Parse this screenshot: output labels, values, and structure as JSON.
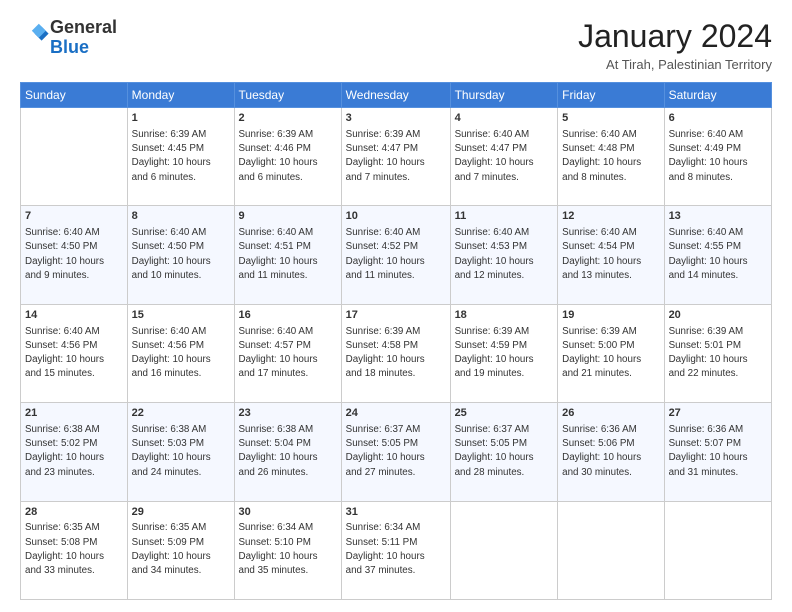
{
  "header": {
    "logo_general": "General",
    "logo_blue": "Blue",
    "month_title": "January 2024",
    "location": "At Tirah, Palestinian Territory"
  },
  "columns": [
    "Sunday",
    "Monday",
    "Tuesday",
    "Wednesday",
    "Thursday",
    "Friday",
    "Saturday"
  ],
  "weeks": [
    [
      {
        "day": "",
        "info": ""
      },
      {
        "day": "1",
        "info": "Sunrise: 6:39 AM\nSunset: 4:45 PM\nDaylight: 10 hours\nand 6 minutes."
      },
      {
        "day": "2",
        "info": "Sunrise: 6:39 AM\nSunset: 4:46 PM\nDaylight: 10 hours\nand 6 minutes."
      },
      {
        "day": "3",
        "info": "Sunrise: 6:39 AM\nSunset: 4:47 PM\nDaylight: 10 hours\nand 7 minutes."
      },
      {
        "day": "4",
        "info": "Sunrise: 6:40 AM\nSunset: 4:47 PM\nDaylight: 10 hours\nand 7 minutes."
      },
      {
        "day": "5",
        "info": "Sunrise: 6:40 AM\nSunset: 4:48 PM\nDaylight: 10 hours\nand 8 minutes."
      },
      {
        "day": "6",
        "info": "Sunrise: 6:40 AM\nSunset: 4:49 PM\nDaylight: 10 hours\nand 8 minutes."
      }
    ],
    [
      {
        "day": "7",
        "info": "Sunrise: 6:40 AM\nSunset: 4:50 PM\nDaylight: 10 hours\nand 9 minutes."
      },
      {
        "day": "8",
        "info": "Sunrise: 6:40 AM\nSunset: 4:50 PM\nDaylight: 10 hours\nand 10 minutes."
      },
      {
        "day": "9",
        "info": "Sunrise: 6:40 AM\nSunset: 4:51 PM\nDaylight: 10 hours\nand 11 minutes."
      },
      {
        "day": "10",
        "info": "Sunrise: 6:40 AM\nSunset: 4:52 PM\nDaylight: 10 hours\nand 11 minutes."
      },
      {
        "day": "11",
        "info": "Sunrise: 6:40 AM\nSunset: 4:53 PM\nDaylight: 10 hours\nand 12 minutes."
      },
      {
        "day": "12",
        "info": "Sunrise: 6:40 AM\nSunset: 4:54 PM\nDaylight: 10 hours\nand 13 minutes."
      },
      {
        "day": "13",
        "info": "Sunrise: 6:40 AM\nSunset: 4:55 PM\nDaylight: 10 hours\nand 14 minutes."
      }
    ],
    [
      {
        "day": "14",
        "info": "Sunrise: 6:40 AM\nSunset: 4:56 PM\nDaylight: 10 hours\nand 15 minutes."
      },
      {
        "day": "15",
        "info": "Sunrise: 6:40 AM\nSunset: 4:56 PM\nDaylight: 10 hours\nand 16 minutes."
      },
      {
        "day": "16",
        "info": "Sunrise: 6:40 AM\nSunset: 4:57 PM\nDaylight: 10 hours\nand 17 minutes."
      },
      {
        "day": "17",
        "info": "Sunrise: 6:39 AM\nSunset: 4:58 PM\nDaylight: 10 hours\nand 18 minutes."
      },
      {
        "day": "18",
        "info": "Sunrise: 6:39 AM\nSunset: 4:59 PM\nDaylight: 10 hours\nand 19 minutes."
      },
      {
        "day": "19",
        "info": "Sunrise: 6:39 AM\nSunset: 5:00 PM\nDaylight: 10 hours\nand 21 minutes."
      },
      {
        "day": "20",
        "info": "Sunrise: 6:39 AM\nSunset: 5:01 PM\nDaylight: 10 hours\nand 22 minutes."
      }
    ],
    [
      {
        "day": "21",
        "info": "Sunrise: 6:38 AM\nSunset: 5:02 PM\nDaylight: 10 hours\nand 23 minutes."
      },
      {
        "day": "22",
        "info": "Sunrise: 6:38 AM\nSunset: 5:03 PM\nDaylight: 10 hours\nand 24 minutes."
      },
      {
        "day": "23",
        "info": "Sunrise: 6:38 AM\nSunset: 5:04 PM\nDaylight: 10 hours\nand 26 minutes."
      },
      {
        "day": "24",
        "info": "Sunrise: 6:37 AM\nSunset: 5:05 PM\nDaylight: 10 hours\nand 27 minutes."
      },
      {
        "day": "25",
        "info": "Sunrise: 6:37 AM\nSunset: 5:05 PM\nDaylight: 10 hours\nand 28 minutes."
      },
      {
        "day": "26",
        "info": "Sunrise: 6:36 AM\nSunset: 5:06 PM\nDaylight: 10 hours\nand 30 minutes."
      },
      {
        "day": "27",
        "info": "Sunrise: 6:36 AM\nSunset: 5:07 PM\nDaylight: 10 hours\nand 31 minutes."
      }
    ],
    [
      {
        "day": "28",
        "info": "Sunrise: 6:35 AM\nSunset: 5:08 PM\nDaylight: 10 hours\nand 33 minutes."
      },
      {
        "day": "29",
        "info": "Sunrise: 6:35 AM\nSunset: 5:09 PM\nDaylight: 10 hours\nand 34 minutes."
      },
      {
        "day": "30",
        "info": "Sunrise: 6:34 AM\nSunset: 5:10 PM\nDaylight: 10 hours\nand 35 minutes."
      },
      {
        "day": "31",
        "info": "Sunrise: 6:34 AM\nSunset: 5:11 PM\nDaylight: 10 hours\nand 37 minutes."
      },
      {
        "day": "",
        "info": ""
      },
      {
        "day": "",
        "info": ""
      },
      {
        "day": "",
        "info": ""
      }
    ]
  ]
}
